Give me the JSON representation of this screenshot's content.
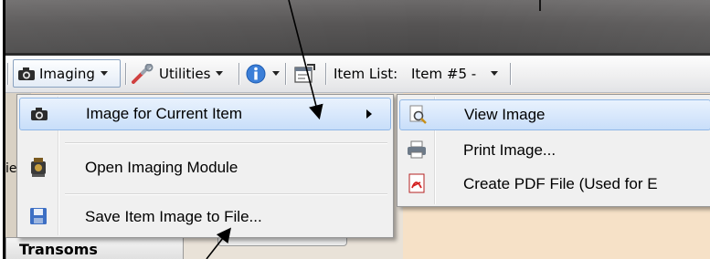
{
  "toolbar": {
    "imaging_label": "Imaging",
    "utilities_label": "Utilities",
    "item_list_label": "Item List:",
    "item_list_value": "Item #5 -"
  },
  "imaging_menu": {
    "items": [
      {
        "label": "Image for Current Item",
        "icon": "camera-icon"
      },
      {
        "label": "Open Imaging Module",
        "icon": "imaging-module-icon"
      },
      {
        "label": "Save Item Image to File...",
        "icon": "save-disk-icon"
      }
    ]
  },
  "image_submenu": {
    "items": [
      {
        "label": "View Image",
        "icon": "magnifier-page-icon"
      },
      {
        "label": "Print Image...",
        "icon": "printer-icon"
      },
      {
        "label": "Create PDF File (Used for E",
        "icon": "pdf-icon"
      }
    ]
  },
  "background": {
    "side_label": "ie",
    "bottom_tab_label": "Transoms"
  },
  "colors": {
    "highlight": "#c8defa",
    "menu_bg": "#f0f0f0",
    "titlebar": "#565454",
    "pdf_red": "#d42020"
  }
}
